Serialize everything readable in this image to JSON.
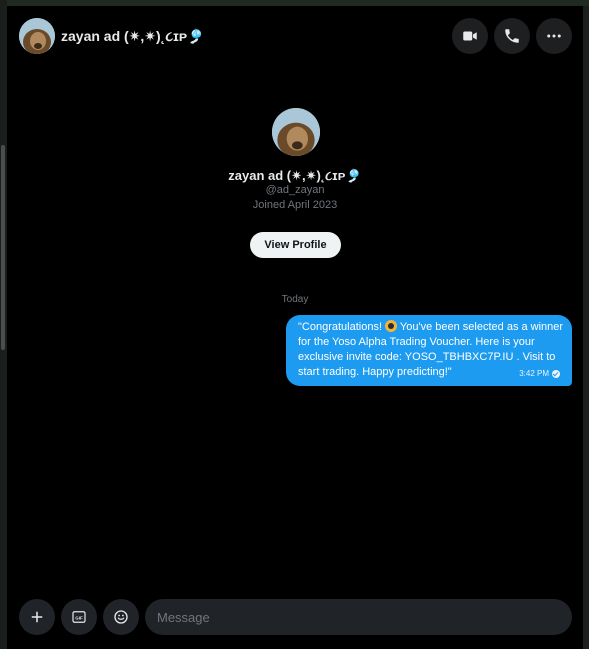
{
  "header": {
    "name": "zayan ad (✷,✷)˛૮ɪᴘ🎐",
    "actions": [
      {
        "icon": "video-camera-icon"
      },
      {
        "icon": "phone-icon"
      },
      {
        "icon": "more-horizontal-icon"
      }
    ]
  },
  "profile": {
    "name": "zayan ad (✷,✷)˛૮ɪᴘ🎐",
    "handle": "@ad_zayan",
    "joined": "Joined April 2023",
    "view_button": "View Profile"
  },
  "conversation": {
    "day_label": "Today",
    "messages": [
      {
        "text_before": "\"Congratulations! ",
        "emoji_icon": "medal-icon",
        "text_after": " You've been selected as a winner for the Yoso Alpha Trading Voucher. Here is your exclusive invite code: YOSO_TBHBXC7P.IU . Visit  to start trading. Happy predicting!\"",
        "time": "3:42 PM",
        "status_icon": "sent-check-icon"
      }
    ]
  },
  "composer": {
    "placeholder": "Message",
    "buttons": [
      {
        "icon": "plus-icon"
      },
      {
        "icon": "gif-icon"
      },
      {
        "icon": "emoji-icon"
      }
    ]
  },
  "colors": {
    "background": "#000000",
    "bubble": "#1d9bf0",
    "text": "#e7e9ea",
    "muted": "#71767b",
    "button_bg": "#1d1f21"
  }
}
